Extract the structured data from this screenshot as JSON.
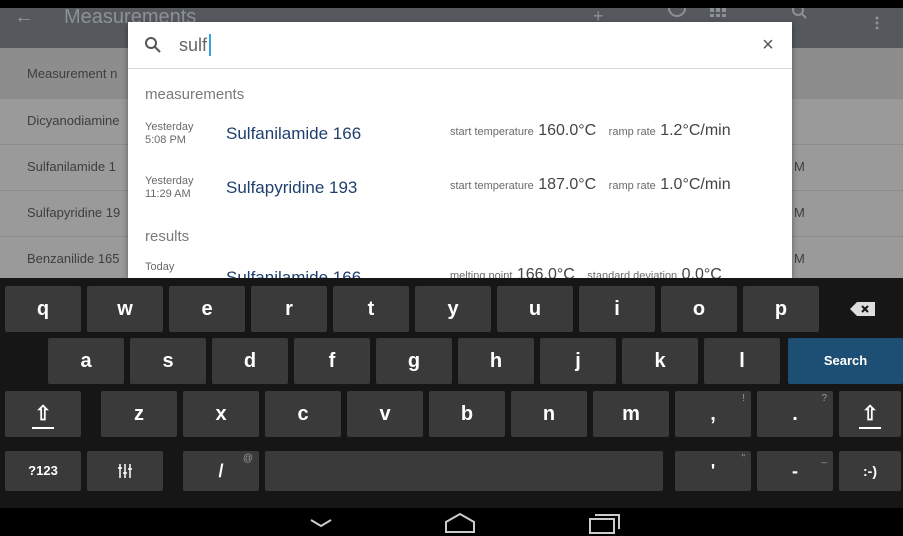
{
  "app": {
    "title": "Measurements",
    "back_glyph": "←",
    "header_label": "Measurement n",
    "rows": [
      {
        "name": "Dicyanodiamine",
        "right": ""
      },
      {
        "name": "Sulfanilamide 1",
        "right": "M"
      },
      {
        "name": "Sulfapyridine 19",
        "right": "M"
      },
      {
        "name": "Benzanilide 165",
        "right": "M"
      }
    ]
  },
  "search": {
    "query": "sulf",
    "close_glyph": "×",
    "sections": [
      {
        "title": "measurements",
        "items": [
          {
            "when_line1": "Yesterday",
            "when_line2": "5:08 PM",
            "title": "Sulfanilamide 166",
            "prop1_label": "start temperature",
            "prop1_value": "160.0°C",
            "prop2_label": "ramp rate",
            "prop2_value": "1.2°C/min"
          },
          {
            "when_line1": "Yesterday",
            "when_line2": "11:29 AM",
            "title": "Sulfapyridine 193",
            "prop1_label": "start temperature",
            "prop1_value": "187.0°C",
            "prop2_label": "ramp rate",
            "prop2_value": "1.0°C/min"
          }
        ]
      },
      {
        "title": "results",
        "items": [
          {
            "when_line1": "Today",
            "when_line2": "",
            "title": "Sulfanilamide 166",
            "prop1_label": "melting point",
            "prop1_value": "166.0°C",
            "prop2_label": "standard deviation",
            "prop2_value": "0.0°C"
          }
        ]
      }
    ]
  },
  "keyboard": {
    "row1": [
      "q",
      "w",
      "e",
      "r",
      "t",
      "y",
      "u",
      "i",
      "o",
      "p"
    ],
    "row2": [
      "a",
      "s",
      "d",
      "f",
      "g",
      "h",
      "j",
      "k",
      "l"
    ],
    "row3": [
      "z",
      "x",
      "c",
      "v",
      "b",
      "n",
      "m"
    ],
    "search_label": "Search",
    "comma_label": ",",
    "comma_hint": "!",
    "period_label": ".",
    "period_hint": "?",
    "symbols_label": "?123",
    "emoji_label": ":-)",
    "slash_label": "/",
    "slash_hint": "@",
    "apostrophe_label": "'",
    "apostrophe_hint": "\"",
    "dash_label": "-",
    "dash_hint": "_",
    "shift_glyph": "⇧"
  }
}
